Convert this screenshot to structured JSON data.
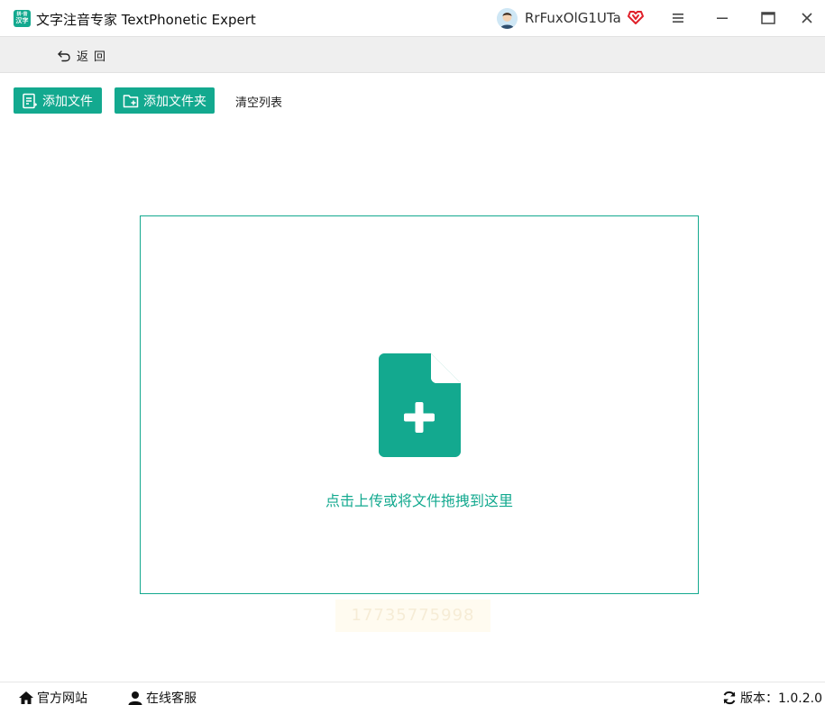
{
  "app": {
    "logo_text_top": "拼·音",
    "logo_text_bottom": "汉字",
    "title": "文字注音专家 TextPhonetic Expert"
  },
  "user": {
    "name": "RrFuxOlG1UTa"
  },
  "nav": {
    "back_label": "返回"
  },
  "toolbar": {
    "add_file_label": "添加文件",
    "add_folder_label": "添加文件夹",
    "clear_label": "清空列表"
  },
  "dropzone": {
    "hint": "点击上传或将文件拖拽到这里"
  },
  "watermark": {
    "text": "17735775998"
  },
  "footer": {
    "site_label": "官方网站",
    "service_label": "在线客服",
    "version_label": "版本：1.0.2.0"
  },
  "colors": {
    "accent": "#13a98f",
    "vip": "#e0202a",
    "navbar_bg": "#efefef"
  },
  "icons": [
    "app-logo",
    "avatar",
    "vip-heart-icon",
    "menu-icon",
    "minimize-icon",
    "maximize-icon",
    "close-icon",
    "back-arrow-icon",
    "file-list-icon",
    "folder-plus-icon",
    "file-plus-icon",
    "home-icon",
    "user-icon",
    "refresh-icon"
  ]
}
